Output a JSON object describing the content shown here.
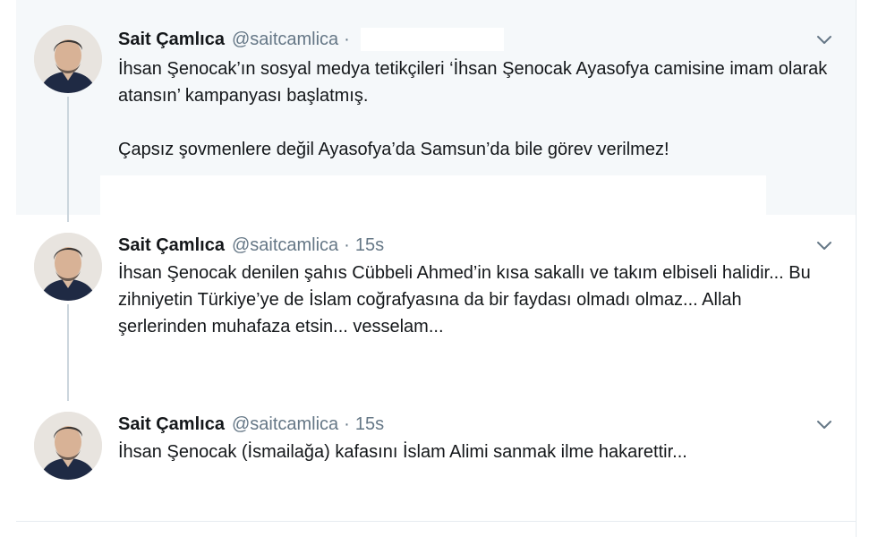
{
  "tweets": [
    {
      "name": "Sait Çamlıca",
      "handle": "@saitcamlica",
      "separator": "·",
      "time": "",
      "paragraphs": [
        "İhsan Şenocak’ın sosyal medya tetikçileri ‘İhsan Şenocak Ayasofya camisine imam olarak atansın’ kampanyası başlatmış.",
        "Çapsız şovmenlere değil Ayasofya’da Samsun’da bile görev verilmez!"
      ]
    },
    {
      "name": "Sait Çamlıca",
      "handle": "@saitcamlica",
      "separator": "·",
      "time": "15s",
      "paragraphs": [
        "İhsan Şenocak denilen şahıs Cübbeli Ahmed’in kısa sakallı ve takım elbiseli halidir... Bu zihniyetin Türkiye’ye de İslam coğrafyasına da bir faydası olmadı olmaz... Allah şerlerinden muhafaza etsin... vesselam..."
      ]
    },
    {
      "name": "Sait Çamlıca",
      "handle": "@saitcamlica",
      "separator": "·",
      "time": "15s",
      "paragraphs": [
        "İhsan Şenocak (İsmailağa) kafasını İslam Alimi sanmak ilme hakarettir..."
      ]
    }
  ],
  "icons": {
    "avatar": "avatar-photo",
    "menu": "chevron-down-icon"
  },
  "colors": {
    "highlight_bg": "#f5f8fa",
    "secondary_text": "#657786",
    "thread_line": "#ccd6dd"
  }
}
